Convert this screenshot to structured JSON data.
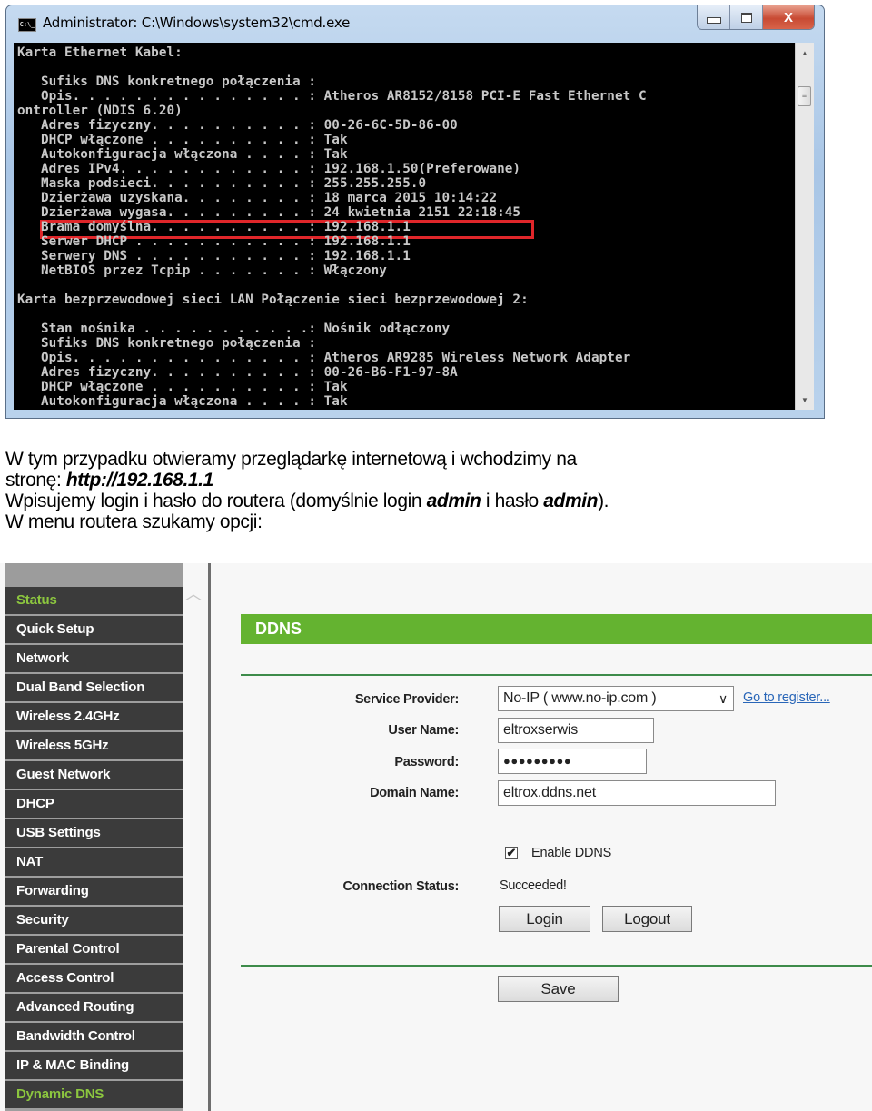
{
  "cmd": {
    "title": "Administrator: C:\\Windows\\system32\\cmd.exe",
    "icon": "cmd-app-icon",
    "window_buttons": [
      "minimize",
      "maximize",
      "close"
    ],
    "close_glyph": "X",
    "lines": [
      "Karta Ethernet Kabel:",
      "",
      "   Sufiks DNS konkretnego połączenia :",
      "   Opis. . . . . . . . . . . . . . . : Atheros AR8152/8158 PCI-E Fast Ethernet C",
      "ontroller (NDIS 6.20)",
      "   Adres fizyczny. . . . . . . . . . : 00-26-6C-5D-86-00",
      "   DHCP włączone . . . . . . . . . . : Tak",
      "   Autokonfiguracja włączona . . . . : Tak",
      "   Adres IPv4. . . . . . . . . . . . : 192.168.1.50(Preferowane)",
      "   Maska podsieci. . . . . . . . . . : 255.255.255.0",
      "   Dzierżawa uzyskana. . . . . . . . : 18 marca 2015 10:14:22",
      "   Dzierżawa wygasa. . . . . . . . . : 24 kwietnia 2151 22:18:45",
      "   Brama domyślna. . . . . . . . . . : 192.168.1.1",
      "   Serwer DHCP . . . . . . . . . . . : 192.168.1.1",
      "   Serwery DNS . . . . . . . . . . . : 192.168.1.1",
      "   NetBIOS przez Tcpip . . . . . . . : Włączony",
      "",
      "Karta bezprzewodowej sieci LAN Połączenie sieci bezprzewodowej 2:",
      "",
      "   Stan nośnika . . . . . . . . . . .: Nośnik odłączony",
      "   Sufiks DNS konkretnego połączenia :",
      "   Opis. . . . . . . . . . . . . . . : Atheros AR9285 Wireless Network Adapter",
      "   Adres fizyczny. . . . . . . . . . : 00-26-B6-F1-97-8A",
      "   DHCP włączone . . . . . . . . . . : Tak",
      "   Autokonfiguracja włączona . . . . : Tak"
    ],
    "highlighted_line": "Brama domyślna",
    "highlight_color": "#e0262a"
  },
  "instructions": {
    "line1": "W tym przypadku otwieramy przeglądarkę internetową i wchodzimy na",
    "line2_prefix": "stronę: ",
    "line2_url": "http://192.168.1.1",
    "line3_a": "Wpisujemy login i hasło do routera (domyślnie login ",
    "line3_login": "admin",
    "line3_b": " i hasło ",
    "line3_password": "admin",
    "line3_c": ").",
    "line4": "W menu routera szukamy opcji:"
  },
  "router": {
    "accent_color": "#64b330",
    "active_menu_color": "#8cc63f",
    "menu": [
      {
        "label": "Status",
        "active": true
      },
      {
        "label": "Quick Setup",
        "active": false
      },
      {
        "label": "Network",
        "active": false
      },
      {
        "label": "Dual Band Selection",
        "active": false
      },
      {
        "label": "Wireless 2.4GHz",
        "active": false
      },
      {
        "label": "Wireless 5GHz",
        "active": false
      },
      {
        "label": "Guest Network",
        "active": false
      },
      {
        "label": "DHCP",
        "active": false
      },
      {
        "label": "USB Settings",
        "active": false
      },
      {
        "label": "NAT",
        "active": false
      },
      {
        "label": "Forwarding",
        "active": false
      },
      {
        "label": "Security",
        "active": false
      },
      {
        "label": "Parental Control",
        "active": false
      },
      {
        "label": "Access Control",
        "active": false
      },
      {
        "label": "Advanced Routing",
        "active": false
      },
      {
        "label": "Bandwidth Control",
        "active": false
      },
      {
        "label": "IP & MAC Binding",
        "active": false
      },
      {
        "label": "Dynamic DNS",
        "active": true
      }
    ],
    "section_title": "DDNS",
    "form": {
      "service_provider_label": "Service Provider:",
      "service_provider_value": "No-IP ( www.no-ip.com )",
      "register_link": "Go to register...",
      "user_name_label": "User Name:",
      "user_name_value": "eltroxserwis",
      "password_label": "Password:",
      "password_value": "●●●●●●●●●",
      "domain_name_label": "Domain Name:",
      "domain_name_value": "eltrox.ddns.net",
      "enable_ddns_label": "Enable DDNS",
      "enable_ddns_checked": true,
      "checkbox_glyph": "✔",
      "connection_status_label": "Connection Status:",
      "connection_status_value": "Succeeded!",
      "login_button": "Login",
      "logout_button": "Logout",
      "save_button": "Save"
    }
  }
}
